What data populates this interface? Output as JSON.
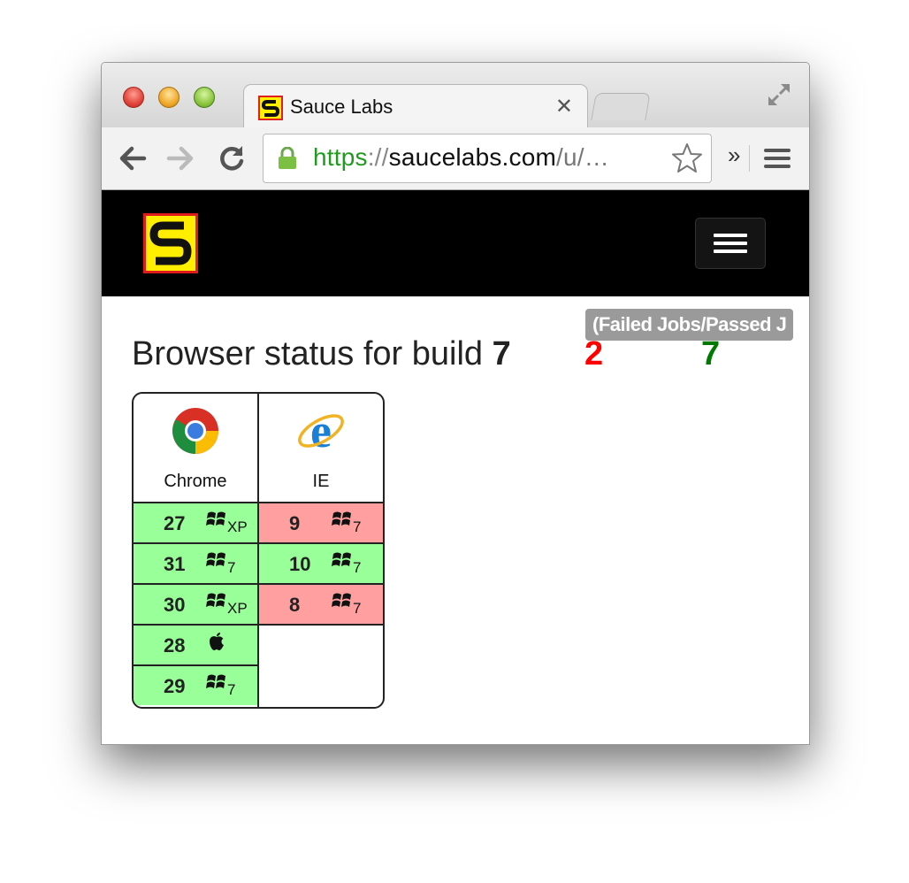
{
  "browser": {
    "tab_title": "Sauce Labs",
    "url": {
      "scheme": "https",
      "separator": "://",
      "host": "saucelabs.com",
      "path": "/u/…"
    },
    "overflow_label": "»"
  },
  "page": {
    "tooltip": "(Failed Jobs/Passed J",
    "heading_prefix": "Browser status for build",
    "build_number": "7",
    "failed_jobs": "2",
    "passed_jobs": "7",
    "colors": {
      "pass": "#99ff99",
      "fail": "#ff9f9f",
      "failed_text": "#ff0000",
      "passed_text": "#007a00"
    }
  },
  "matrix": {
    "chrome": {
      "name": "Chrome",
      "icon": "chrome-icon",
      "jobs": [
        {
          "version": "27",
          "os": "windows-icon",
          "os_version": "XP",
          "status": "pass"
        },
        {
          "version": "31",
          "os": "windows-icon",
          "os_version": "7",
          "status": "pass"
        },
        {
          "version": "30",
          "os": "windows-icon",
          "os_version": "XP",
          "status": "pass"
        },
        {
          "version": "28",
          "os": "apple-icon",
          "os_version": "",
          "status": "pass"
        },
        {
          "version": "29",
          "os": "windows-icon",
          "os_version": "7",
          "status": "pass"
        }
      ]
    },
    "ie": {
      "name": "IE",
      "icon": "internet-explorer-icon",
      "jobs": [
        {
          "version": "9",
          "os": "windows-icon",
          "os_version": "7",
          "status": "fail"
        },
        {
          "version": "10",
          "os": "windows-icon",
          "os_version": "7",
          "status": "pass"
        },
        {
          "version": "8",
          "os": "windows-icon",
          "os_version": "7",
          "status": "fail"
        }
      ]
    }
  }
}
